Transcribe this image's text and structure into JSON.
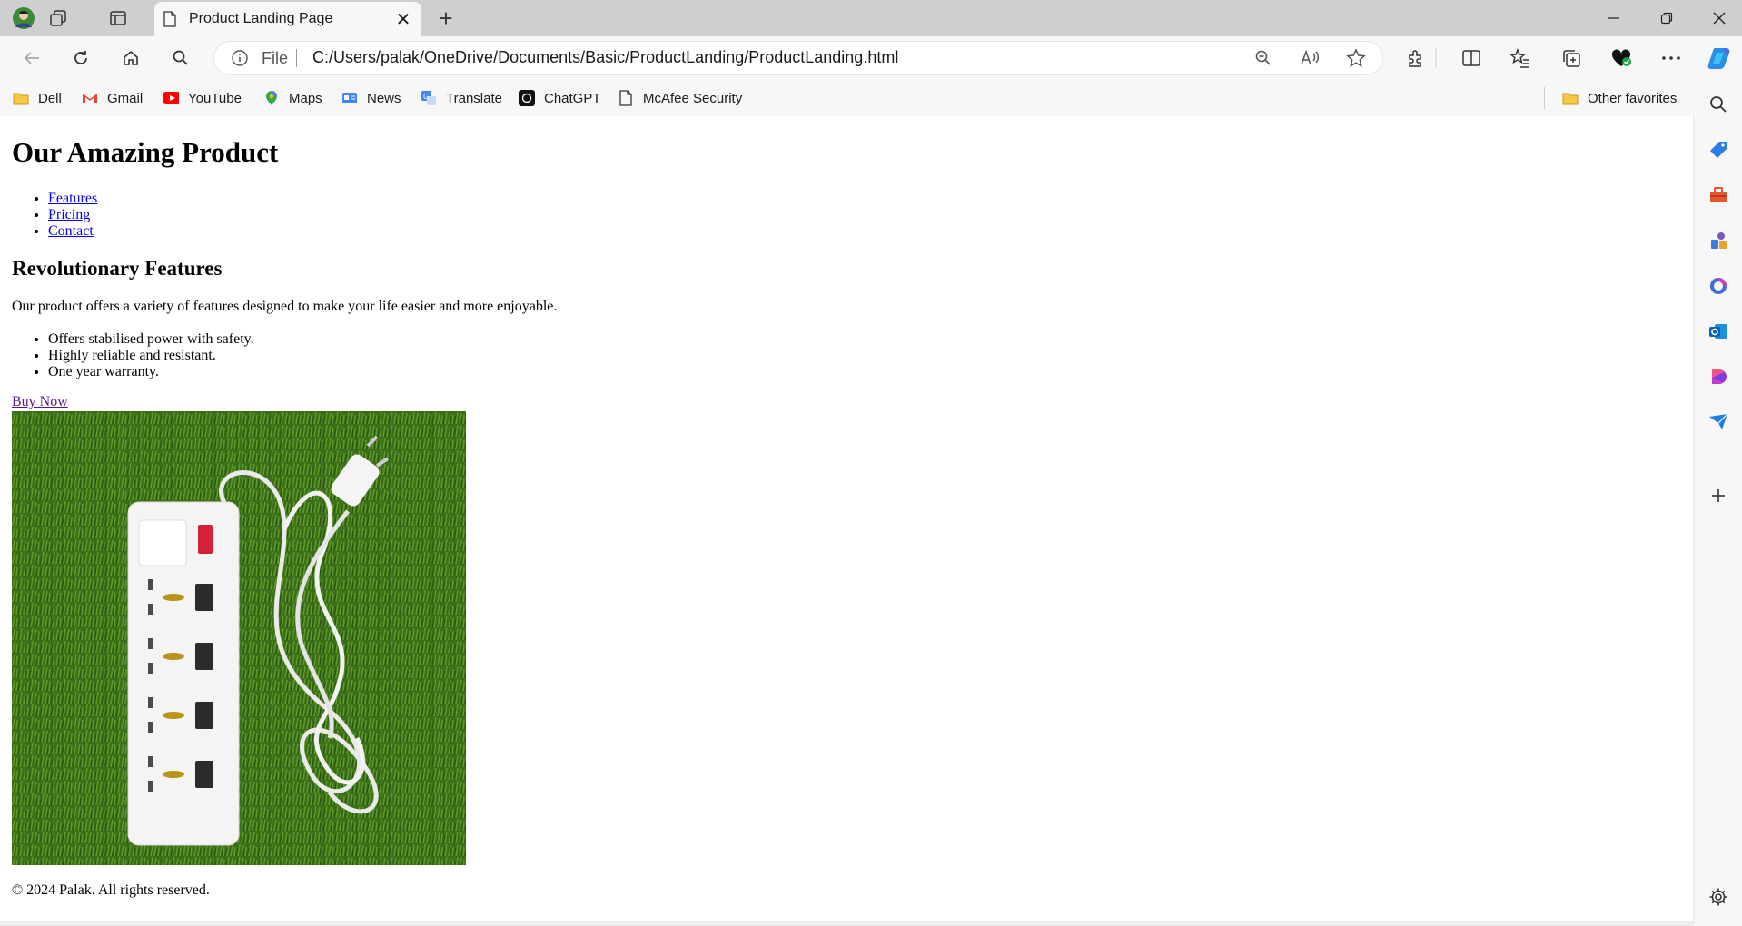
{
  "browser": {
    "tab_title": "Product Landing Page",
    "address": {
      "scheme_label": "File",
      "url": "C:/Users/palak/OneDrive/Documents/Basic/ProductLanding/ProductLanding.html"
    },
    "favorites": [
      {
        "label": "Dell",
        "icon": "folder-icon"
      },
      {
        "label": "Gmail",
        "icon": "gmail-icon"
      },
      {
        "label": "YouTube",
        "icon": "youtube-icon"
      },
      {
        "label": "Maps",
        "icon": "maps-icon"
      },
      {
        "label": "News",
        "icon": "news-icon"
      },
      {
        "label": "Translate",
        "icon": "translate-icon"
      },
      {
        "label": "ChatGPT",
        "icon": "chatgpt-icon"
      },
      {
        "label": "McAfee Security",
        "icon": "document-icon"
      }
    ],
    "other_favorites": "Other favorites"
  },
  "page": {
    "title": "Our Amazing Product",
    "nav": [
      "Features",
      "Pricing",
      "Contact"
    ],
    "features_heading": "Revolutionary Features",
    "intro": "Our product offers a variety of features designed to make your life easier and more enjoyable.",
    "feature_list": [
      "Offers stabilised power with safety.",
      "Highly reliable and resistant.",
      "One year warranty."
    ],
    "buy_label": "Buy Now",
    "footer": "© 2024 Palak. All rights reserved."
  }
}
